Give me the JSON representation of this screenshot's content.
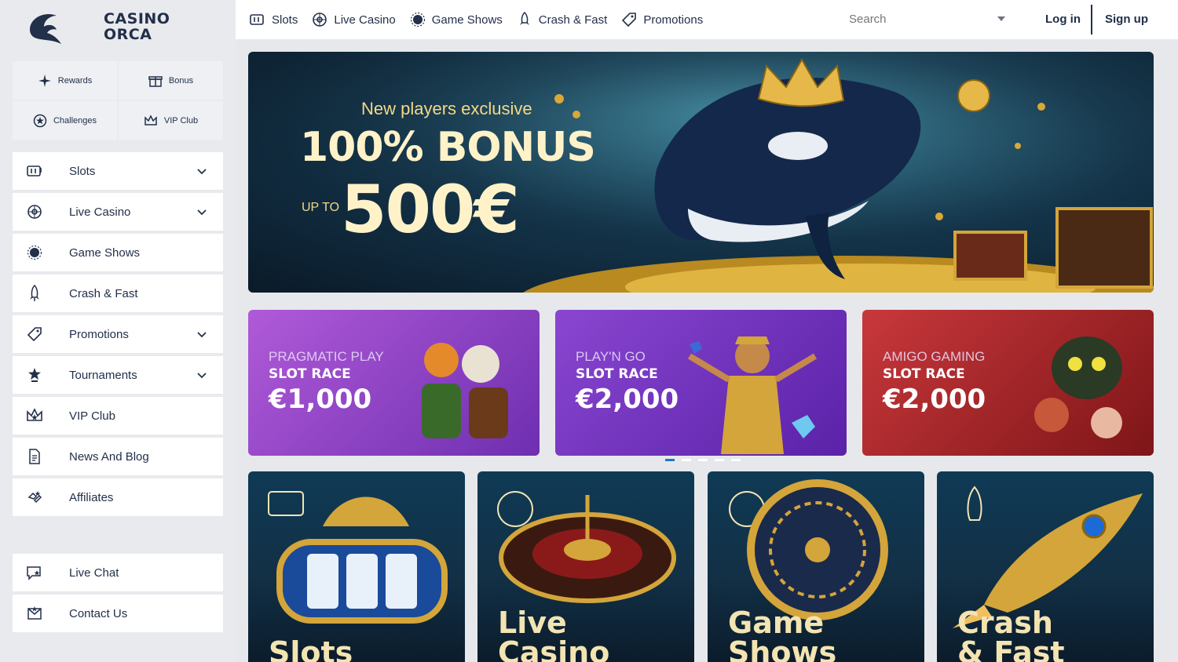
{
  "brand": {
    "name_line1": "CASINO",
    "name_line2": "ORCA"
  },
  "quick_links": [
    {
      "label": "Rewards",
      "icon": "sparkle-icon"
    },
    {
      "label": "Bonus",
      "icon": "gift-icon"
    },
    {
      "label": "Challenges",
      "icon": "star-badge-icon"
    },
    {
      "label": "VIP Club",
      "icon": "crown-icon"
    }
  ],
  "sidebar": {
    "items": [
      {
        "label": "Slots",
        "icon": "slot-machine-icon",
        "has_chevron": true
      },
      {
        "label": "Live Casino",
        "icon": "roulette-icon",
        "has_chevron": true
      },
      {
        "label": "Game Shows",
        "icon": "wheel-icon",
        "has_chevron": false
      },
      {
        "label": "Crash & Fast",
        "icon": "rocket-icon",
        "has_chevron": false
      },
      {
        "label": "Promotions",
        "icon": "tag-icon",
        "has_chevron": true
      },
      {
        "label": "Tournaments",
        "icon": "trophy-icon",
        "has_chevron": true
      },
      {
        "label": "VIP Club",
        "icon": "crown-icon",
        "has_chevron": false
      },
      {
        "label": "News And Blog",
        "icon": "document-icon",
        "has_chevron": false
      },
      {
        "label": "Affiliates",
        "icon": "handshake-icon",
        "has_chevron": false
      }
    ],
    "support": [
      {
        "label": "Live Chat",
        "icon": "chat-icon"
      },
      {
        "label": "Contact Us",
        "icon": "envelope-icon"
      }
    ]
  },
  "topnav": {
    "items": [
      {
        "label": "Slots",
        "icon": "slot-machine-icon"
      },
      {
        "label": "Live Casino",
        "icon": "roulette-icon"
      },
      {
        "label": "Game Shows",
        "icon": "wheel-icon"
      },
      {
        "label": "Crash & Fast",
        "icon": "rocket-icon"
      },
      {
        "label": "Promotions",
        "icon": "tag-icon"
      }
    ],
    "search_placeholder": "Search",
    "login_label": "Log in",
    "signup_label": "Sign up"
  },
  "hero": {
    "kicker": "New players exclusive",
    "bonus": "100% BONUS",
    "upto": "UP TO",
    "amount": "500€"
  },
  "promos": [
    {
      "provider": "PRAGMATIC PLAY",
      "race": "SLOT RACE",
      "amount": "€1,000",
      "color_from": "#b05ad8",
      "color_to": "#6e2fb0"
    },
    {
      "provider": "PLAY'N GO",
      "race": "SLOT RACE",
      "amount": "€2,000",
      "color_from": "#8a46d0",
      "color_to": "#5a22a8"
    },
    {
      "provider": "AMIGO GAMING",
      "race": "SLOT RACE",
      "amount": "€2,000",
      "color_from": "#c8383b",
      "color_to": "#7e1518"
    }
  ],
  "carousel": {
    "slides": 5,
    "active": 1
  },
  "categories": [
    {
      "line1": "Slots",
      "line2": ""
    },
    {
      "line1": "Live",
      "line2": "Casino"
    },
    {
      "line1": "Game",
      "line2": "Shows"
    },
    {
      "line1": "Crash",
      "line2": "& Fast"
    }
  ],
  "colors": {
    "accent": "#1e78c8",
    "text": "#22304a",
    "gold": "#f5d886"
  }
}
